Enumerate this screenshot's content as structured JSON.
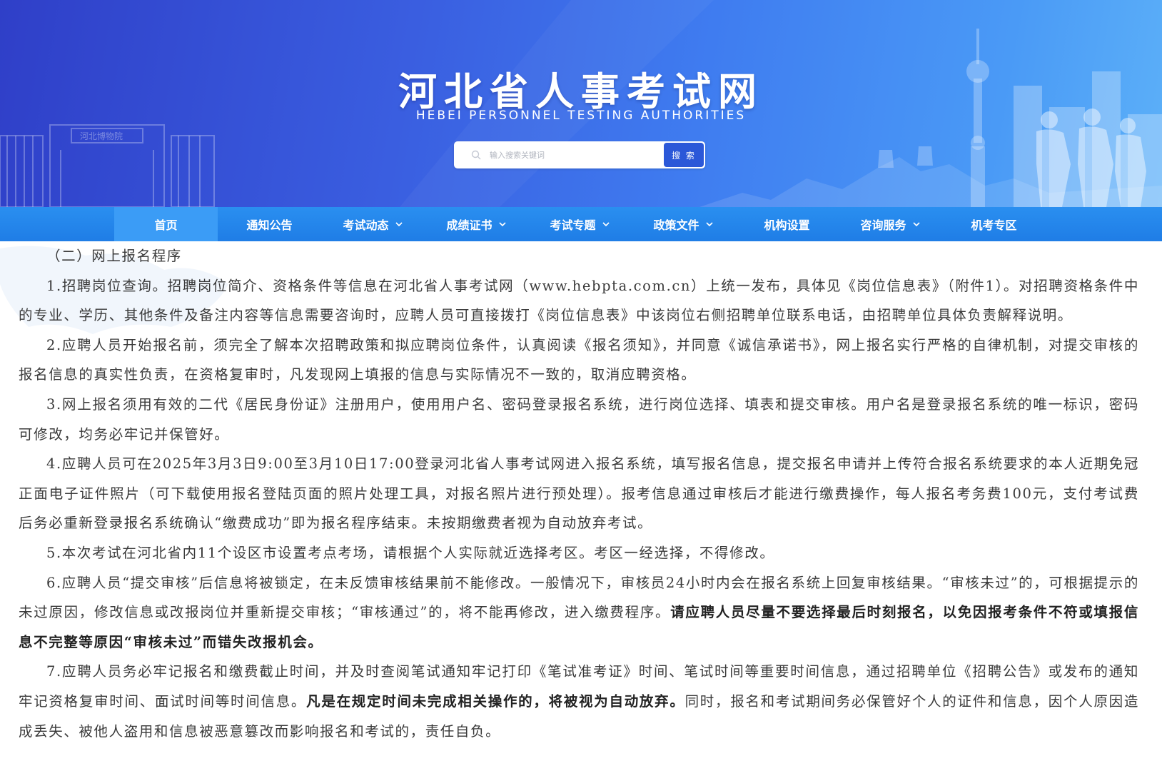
{
  "header": {
    "site_title": "河北省人事考试网",
    "site_subtitle": "HEBEI PERSONNEL TESTING AUTHORITIES",
    "search": {
      "placeholder": "输入搜索关键词",
      "button_label": "搜 索"
    },
    "banner_sign_text": "河北博物院"
  },
  "nav": {
    "items": [
      {
        "label": "首页",
        "dropdown": false,
        "active": true
      },
      {
        "label": "通知公告",
        "dropdown": false,
        "active": false
      },
      {
        "label": "考试动态",
        "dropdown": true,
        "active": false
      },
      {
        "label": "成绩证书",
        "dropdown": true,
        "active": false
      },
      {
        "label": "考试专题",
        "dropdown": true,
        "active": false
      },
      {
        "label": "政策文件",
        "dropdown": true,
        "active": false
      },
      {
        "label": "机构设置",
        "dropdown": false,
        "active": false
      },
      {
        "label": "咨询服务",
        "dropdown": true,
        "active": false
      },
      {
        "label": "机考专区",
        "dropdown": false,
        "active": false
      }
    ]
  },
  "article": {
    "section_heading": "（二）网上报名程序",
    "paragraphs": [
      {
        "parts": [
          {
            "text": "1.招聘岗位查询。招聘岗位简介、资格条件等信息在河北省人事考试网（www.hebpta.com.cn）上统一发布，具体见《岗位信息表》（附件1）。对招聘资格条件中的专业、学历、其他条件及备注内容等信息需要咨询时，应聘人员可直接拨打《岗位信息表》中该岗位右侧招聘单位联系电话，由招聘单位具体负责解释说明。",
            "bold": false
          }
        ]
      },
      {
        "parts": [
          {
            "text": "2.应聘人员开始报名前，须完全了解本次招聘政策和拟应聘岗位条件，认真阅读《报名须知》，并同意《诚信承诺书》，网上报名实行严格的自律机制，对提交审核的报名信息的真实性负责，在资格复审时，凡发现网上填报的信息与实际情况不一致的，取消应聘资格。",
            "bold": false
          }
        ]
      },
      {
        "parts": [
          {
            "text": "3.网上报名须用有效的二代《居民身份证》注册用户，使用用户名、密码登录报名系统，进行岗位选择、填表和提交审核。用户名是登录报名系统的唯一标识，密码可修改，均务必牢记并保管好。",
            "bold": false
          }
        ]
      },
      {
        "parts": [
          {
            "text": "4.应聘人员可在2025年3月3日9:00至3月10日17:00登录河北省人事考试网进入报名系统，填写报名信息，提交报名申请并上传符合报名系统要求的本人近期免冠正面电子证件照片（可下载使用报名登陆页面的照片处理工具，对报名照片进行预处理）。报考信息通过审核后才能进行缴费操作，每人报名考务费100元，支付考试费后务必重新登录报名系统确认“缴费成功”即为报名程序结束。未按期缴费者视为自动放弃考试。",
            "bold": false
          }
        ]
      },
      {
        "parts": [
          {
            "text": "5.本次考试在河北省内11个设区市设置考点考场，请根据个人实际就近选择考区。考区一经选择，不得修改。",
            "bold": false
          }
        ]
      },
      {
        "parts": [
          {
            "text": "6.应聘人员“提交审核”后信息将被锁定，在未反馈审核结果前不能修改。一般情况下，审核员24小时内会在报名系统上回复审核结果。“审核未过”的，可根据提示的未过原因，修改信息或改报岗位并重新提交审核；“审核通过”的，将不能再修改，进入缴费程序。",
            "bold": false
          },
          {
            "text": "请应聘人员尽量不要选择最后时刻报名，以免因报考条件不符或填报信息不完整等原因“审核未过”而错失改报机会。",
            "bold": true
          }
        ]
      },
      {
        "parts": [
          {
            "text": "7.应聘人员务必牢记报名和缴费截止时间，并及时查阅笔试通知牢记打印《笔试准考证》时间、笔试时间等重要时间信息，通过招聘单位《招聘公告》或发布的通知牢记资格复审时间、面试时间等时间信息。",
            "bold": false
          },
          {
            "text": "凡是在规定时间未完成相关操作的，将被视为自动放弃。",
            "bold": true
          },
          {
            "text": "同时，报名和考试期间务必保管好个人的证件和信息，因个人原因造成丢失、被他人盗用和信息被恶意篡改而影响报名和考试的，责任自负。",
            "bold": false
          }
        ]
      }
    ]
  },
  "colors": {
    "banner_left": "#2f3fc8",
    "banner_right": "#5cb0f8",
    "nav_bg": "#1f7de6",
    "nav_active": "#3b9cf6",
    "search_button": "#2b58d8"
  },
  "icons": {
    "search": "magnifier-icon",
    "dropdown": "chevron-down-icon"
  }
}
